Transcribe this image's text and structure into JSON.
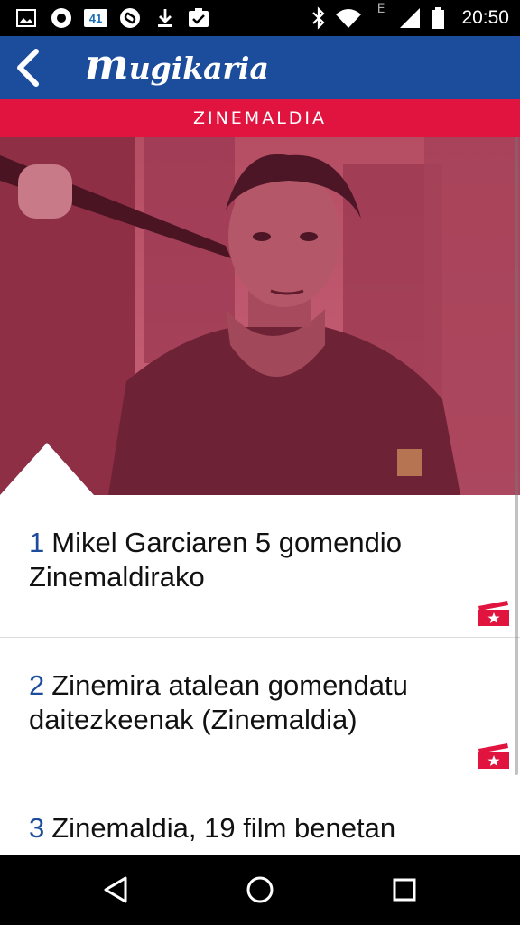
{
  "status_bar": {
    "time": "20:50",
    "badge_number": "41",
    "network_type": "E",
    "icons": [
      "gallery-icon",
      "opera-icon",
      "badge-icon",
      "shazam-icon",
      "download-icon",
      "clipboard-icon",
      "bluetooth-icon",
      "wifi-icon",
      "signal-icon",
      "battery-icon"
    ]
  },
  "header": {
    "logo_initial": "m",
    "logo_rest": "ugikaria",
    "background_color": "#1c4d9c"
  },
  "section": {
    "title": "ZINEMALDIA",
    "color": "#e0143f"
  },
  "articles": [
    {
      "number": "1",
      "title": "Mikel Garciaren 5 gomendio Zinemaldirako"
    },
    {
      "number": "2",
      "title": "Zinemira atalean gomendatu daitezkeenak (Zinemaldia)"
    },
    {
      "number": "3",
      "title": "Zinemaldia, 19 film benetan"
    }
  ],
  "colors": {
    "accent_blue": "#1c4d9c",
    "accent_red": "#e0143f"
  }
}
